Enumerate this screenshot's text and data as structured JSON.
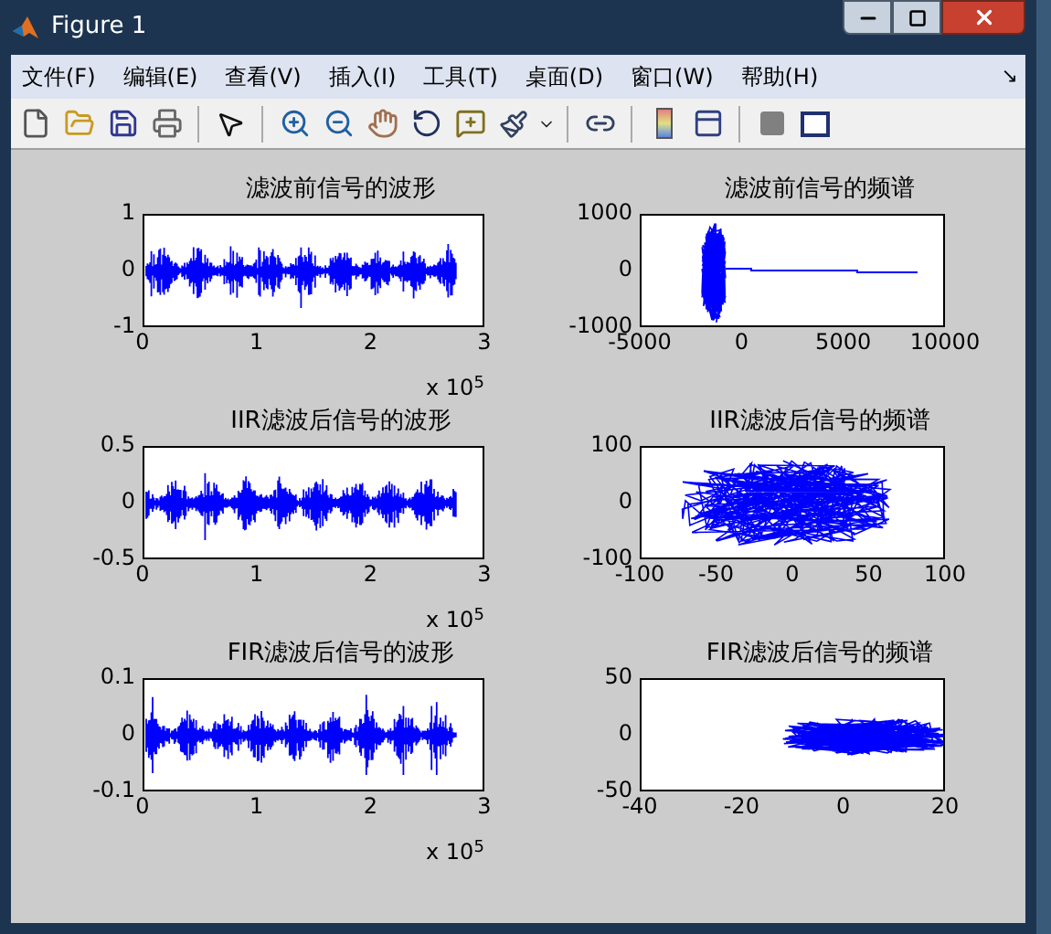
{
  "window": {
    "title": "Figure 1"
  },
  "menu": [
    "文件(F)",
    "编辑(E)",
    "查看(V)",
    "插入(I)",
    "工具(T)",
    "桌面(D)",
    "窗口(W)",
    "帮助(H)"
  ],
  "menu_dock": "↘",
  "plots": [
    {
      "kind": "waveform",
      "title": "滤波前信号的波形",
      "yticks": [
        "1",
        "0",
        "-1"
      ],
      "xticks": [
        "0",
        "1",
        "2",
        "3"
      ],
      "exponent": "x 10$^{5}$"
    },
    {
      "kind": "spectrum",
      "title": "滤波前信号的频谱",
      "yticks": [
        "1000",
        "0",
        "-1000"
      ],
      "xticks": [
        "-5000",
        "0",
        "5000",
        "10000"
      ]
    },
    {
      "kind": "waveform",
      "title": "IIR滤波后信号的波形",
      "yticks": [
        "0.5",
        "0",
        "-0.5"
      ],
      "xticks": [
        "0",
        "1",
        "2",
        "3"
      ],
      "exponent": "x 10$^{5}$"
    },
    {
      "kind": "spectrum",
      "title": "IIR滤波后信号的频谱",
      "yticks": [
        "100",
        "0",
        "-100"
      ],
      "xticks": [
        "-100",
        "-50",
        "0",
        "50",
        "100"
      ]
    },
    {
      "kind": "waveform",
      "title": "FIR滤波后信号的波形",
      "yticks": [
        "0.1",
        "0",
        "-0.1"
      ],
      "xticks": [
        "0",
        "1",
        "2",
        "3"
      ],
      "exponent": "x 10$^{5}$"
    },
    {
      "kind": "spectrum",
      "title": "FIR滤波后信号的频谱",
      "yticks": [
        "50",
        "0",
        "-50"
      ],
      "xticks": [
        "-40",
        "-20",
        "0",
        "20"
      ]
    }
  ]
}
